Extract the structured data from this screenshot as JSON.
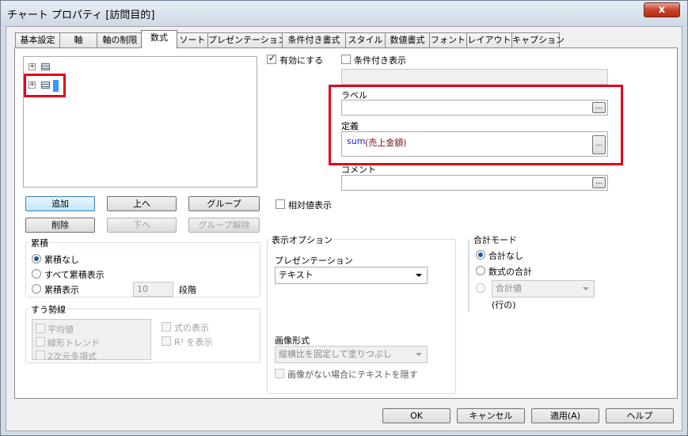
{
  "window": {
    "title": "チャート プロパティ [訪問目的]",
    "close": "x"
  },
  "tabs": [
    "基本設定",
    "軸",
    "軸の制限",
    "数式",
    "ソート",
    "プレゼンテーション",
    "条件付き書式",
    "スタイル",
    "数値書式",
    "フォント",
    "レイアウト",
    "キャプション"
  ],
  "left": {
    "buttons": {
      "add": "追加",
      "up": "上へ",
      "group": "グループ",
      "delete": "削除",
      "down": "下へ",
      "ungroup": "グループ解除"
    },
    "accumulation": {
      "title": "累積",
      "none": "累積なし",
      "all": "すべて累積表示",
      "show": "累積表示",
      "steps_value": "10",
      "steps_unit": "段階"
    },
    "trend": {
      "title": "すう勢線",
      "items": [
        "平均値",
        "線形トレンド",
        "2次元多項式"
      ],
      "show_formula": "式の表示",
      "show_r2": "R² を表示"
    }
  },
  "right": {
    "enable": "有効にする",
    "conditional": "条件付き表示",
    "label_title": "ラベル",
    "label_value": "",
    "definition_title": "定義",
    "definition_func": "sum",
    "definition_arg": "(売上金額)",
    "comment_title": "コメント",
    "ellipsis": "...",
    "relative": "相対値表示"
  },
  "display": {
    "title": "表示オプション",
    "presentation_label": "プレゼンテーション",
    "presentation_value": "テキスト",
    "image_label": "画像形式",
    "image_value": "縦横比を固定して塗りつぶし",
    "hide_text": "画像がない場合にテキストを隠す"
  },
  "total": {
    "title": "合計モード",
    "none": "合計なし",
    "expr": "数式の合計",
    "combo": "合計値",
    "rows": "(行の)"
  },
  "footer": {
    "ok": "OK",
    "cancel": "キャンセル",
    "apply": "適用(A)",
    "help": "ヘルプ"
  },
  "colors": {
    "highlight": "#e3001b",
    "func": "#1a1ad8",
    "arg": "#7a1010"
  }
}
